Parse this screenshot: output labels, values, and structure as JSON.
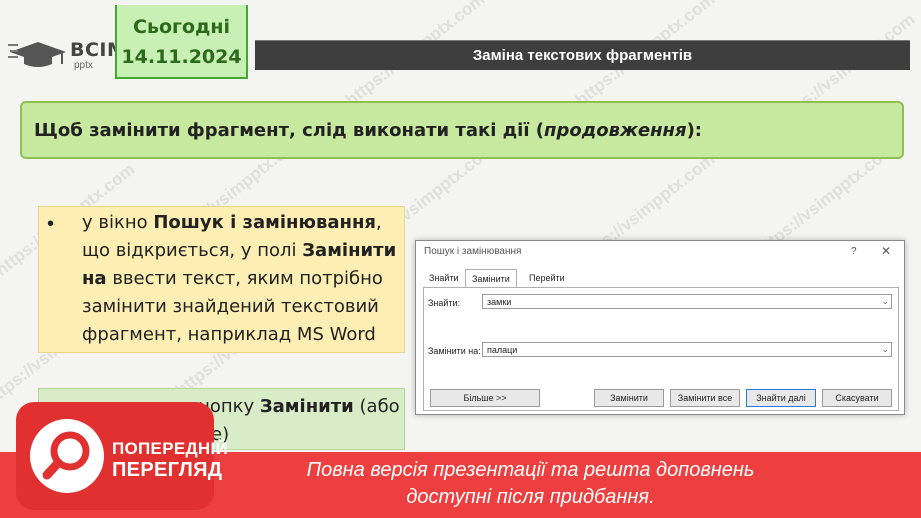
{
  "logo": {
    "text": "ВСІМ",
    "sub": "pptx"
  },
  "date_box": {
    "label": "Сьогодні",
    "date": "14.11.2024"
  },
  "title": "Заміна текстових фрагментів",
  "instruction": {
    "before": "Щоб замінити фрагмент, слід виконати такі дії (",
    "italic": "продовження",
    "after": "):"
  },
  "step1": {
    "bullet": "•",
    "l1_pre": "у вікно ",
    "l1_bold": "Пошук і замінювання",
    "l1_post": ",",
    "l2_pre": "що відкриється, у полі ",
    "l2_bold": "Замінити",
    "l3_bold": "на",
    "l3_post": " ввести текст, яким потрібно",
    "l4": "замінити знайдений текстовий",
    "l5": "фрагмент, наприклад MS Word"
  },
  "step2": {
    "bullet": "•",
    "l1_pre": "натиснути кнопку ",
    "l1_bold": "Замінити",
    "l1_post": " (або",
    "l2": "е)"
  },
  "dialog": {
    "title": "Пошук і замінювання",
    "help": "?",
    "close": "✕",
    "tabs": [
      "Знайти",
      "Замінити",
      "Перейти"
    ],
    "find_label": "Знайти:",
    "find_value": "замки",
    "replace_label": "Замінити на:",
    "replace_value": "палаци",
    "dropdown_arrow": "⌄",
    "buttons": {
      "more": "Більше >>",
      "replace": "Замінити",
      "replace_all": "Замінити все",
      "find_next": "Знайти далі",
      "cancel": "Скасувати"
    }
  },
  "watermark": "https://vsimpptx.com",
  "badge": {
    "l1": "ПОПЕРЕДНІЙ",
    "l2": "ПЕРЕГЛЯД"
  },
  "banner": {
    "l1": "Повна версія презентації та решта доповнень",
    "l2": "доступні після придбання."
  },
  "colors": {
    "title_bar": "#3e3e3e",
    "instruction_bg": "#c6e99f",
    "step1_bg": "#fdefb3",
    "step2_bg": "#d7ecc7",
    "banner": "#ed3f3f"
  }
}
